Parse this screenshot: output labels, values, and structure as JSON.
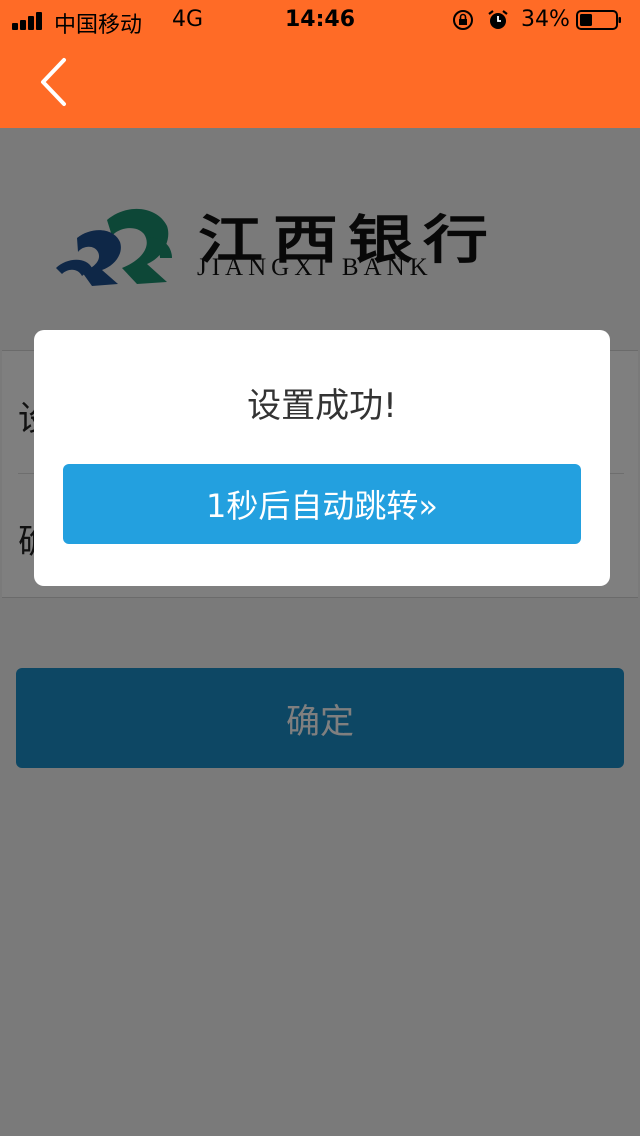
{
  "status_bar": {
    "carrier": "中国移动",
    "network": "4G",
    "time": "14:46",
    "battery": "34%",
    "icons": [
      "signal-icon",
      "orientation-lock-icon",
      "alarm-icon",
      "battery-icon"
    ]
  },
  "nav": {
    "back_icon": "chevron-left-icon"
  },
  "logo": {
    "name_cn": "江西银行",
    "name_en": "JIANGXI BANK"
  },
  "form": {
    "row1_label": "设",
    "row2_label": "确"
  },
  "confirm_button": {
    "label": "确定"
  },
  "modal": {
    "title": "设置成功!",
    "button_label": "1秒后自动跳转»"
  },
  "colors": {
    "header": "#ff6b26",
    "primary_button": "#1b8ec9",
    "modal_button": "#23a0df",
    "logo_green": "#1a8f6e",
    "logo_blue": "#1d4f8f"
  }
}
